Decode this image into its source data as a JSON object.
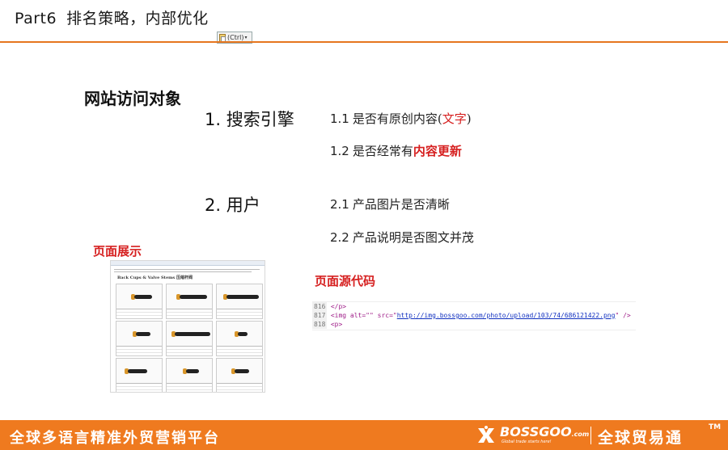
{
  "header": {
    "part": "Part6",
    "title": "排名策略，内部优化",
    "paste_chip": "(Ctrl)"
  },
  "section_title": "网站访问对象",
  "topics": [
    {
      "label": "1. 搜索引擎",
      "items": [
        {
          "num": "1.1",
          "text": "是否有原创内容(",
          "highlight": "文字",
          "suffix": ")"
        },
        {
          "num": "1.2",
          "text": "是否经常有",
          "highlight": "内容更新",
          "suffix": ""
        }
      ]
    },
    {
      "label": "2. 用户",
      "items": [
        {
          "num": "2.1",
          "text": "产品图片是否清晰"
        },
        {
          "num": "2.2",
          "text": "产品说明是否图文并茂"
        }
      ]
    }
  ],
  "page_display_label": "页面展示",
  "source_code_label": "页面源代码",
  "thumbnail": {
    "heading": "Back Cups & Valve Stems 压缩杆阀"
  },
  "code": [
    {
      "line": "816",
      "html": "</p>"
    },
    {
      "line": "817",
      "pre": "<img alt=\"\" src=\"",
      "url": "http://img.bossgoo.com/photo/upload/103/74/686121422.png",
      "post": "\" />"
    },
    {
      "line": "818",
      "html": "<p>"
    }
  ],
  "footer": {
    "slogan": "全球多语言精准外贸营销平台",
    "logo": "BOSSGOO",
    "logo_suffix": ".com",
    "logo_tagline": "Global trade starts here!",
    "logo_cn": "全球贸易通",
    "tm": "TM"
  },
  "colors": {
    "accent": "#ef7a1f",
    "highlight": "#d62020"
  }
}
